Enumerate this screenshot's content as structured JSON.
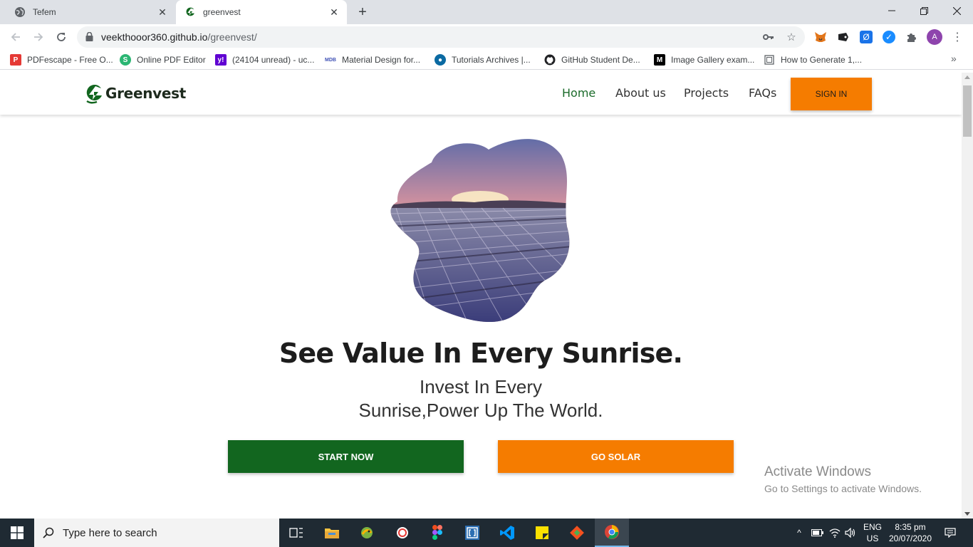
{
  "browser": {
    "tabs": [
      {
        "title": "Tefem",
        "icon": "globe-icon"
      },
      {
        "title": "greenvest",
        "icon": "greenvest-favicon"
      }
    ],
    "url_host": "veekthooor360.github.io",
    "url_path": "/greenvest/",
    "avatar_letter": "A",
    "bookmarks": [
      {
        "label": "PDFescape - Free O...",
        "icon": "pdfescape-icon"
      },
      {
        "label": "Online PDF Editor",
        "icon": "sejda-icon"
      },
      {
        "label": "(24104 unread) - uc...",
        "icon": "yahoo-icon"
      },
      {
        "label": "Material Design for...",
        "icon": "mdb-icon"
      },
      {
        "label": "Tutorials Archives |...",
        "icon": "tutorials-icon"
      },
      {
        "label": "GitHub Student De...",
        "icon": "github-icon"
      },
      {
        "label": "Image Gallery exam...",
        "icon": "medium-icon"
      },
      {
        "label": "How to Generate 1,...",
        "icon": "page-icon"
      }
    ]
  },
  "site": {
    "brand": "Greenvest",
    "nav": [
      {
        "label": "Home",
        "active": true
      },
      {
        "label": "About us",
        "active": false
      },
      {
        "label": "Projects",
        "active": false
      },
      {
        "label": "FAQs",
        "active": false
      }
    ],
    "signin_label": "SIGN IN",
    "headline": "See Value In Every Sunrise.",
    "subline_1": "Invest In Every",
    "subline_2": "Sunrise,Power Up The World.",
    "cta_start": "START NOW",
    "cta_solar": "GO SOLAR",
    "colors": {
      "brand_green": "#12661f",
      "accent_orange": "#f57c00",
      "nav_active": "#1b6b2a"
    }
  },
  "watermark": {
    "line1": "Activate Windows",
    "line2": "Go to Settings to activate Windows."
  },
  "taskbar": {
    "search_placeholder": "Type here to search",
    "language": "ENG",
    "region": "US",
    "time": "8:35 pm",
    "date": "20/07/2020"
  }
}
